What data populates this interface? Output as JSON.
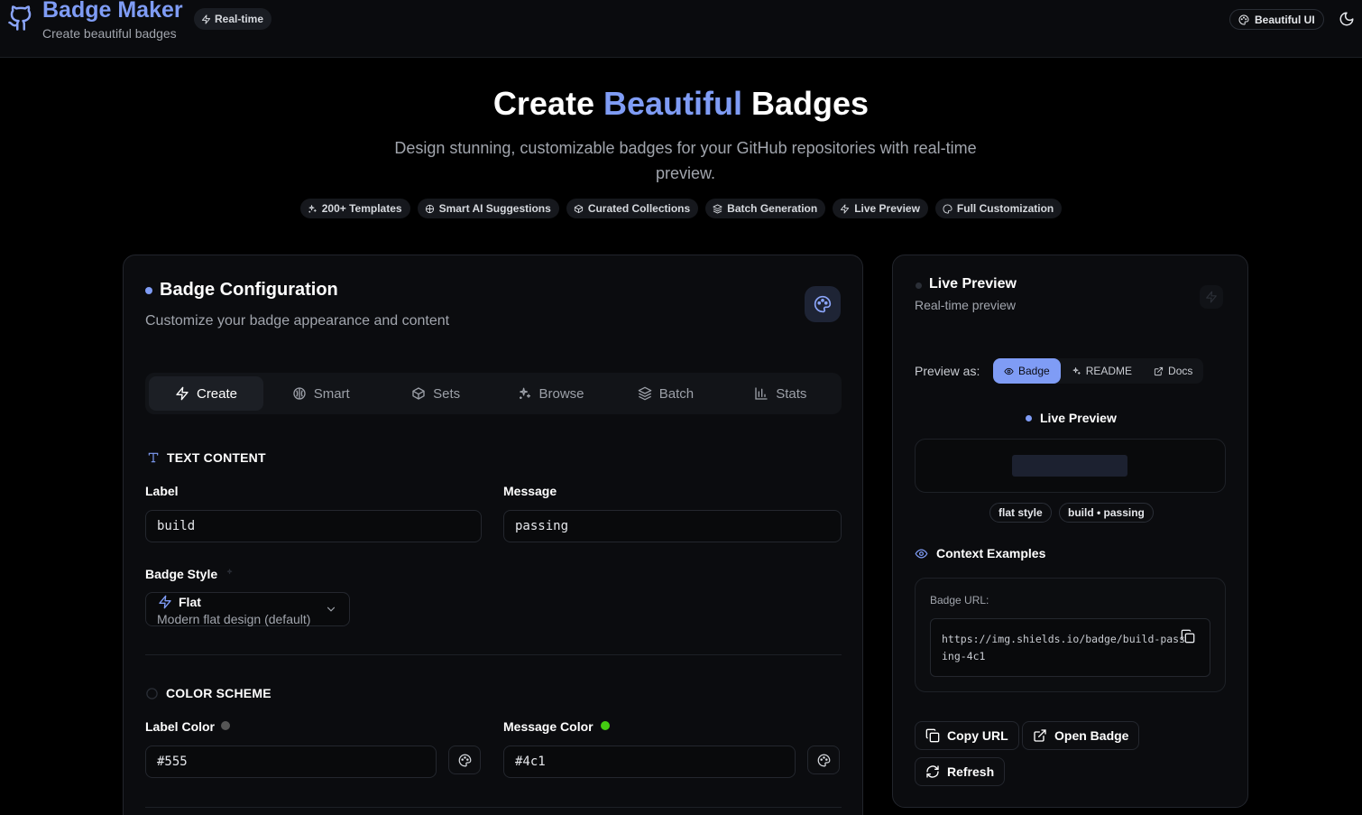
{
  "header": {
    "brand_title": "Badge Maker",
    "brand_subtitle": "Create beautiful badges",
    "realtime_pill": "Real-time",
    "beautiful_ui_label": "Beautiful UI",
    "theme_icon": "moon-icon"
  },
  "hero": {
    "title_pre": "Create",
    "title_accent": "Beautiful",
    "title_post": "Badges",
    "subtitle": "Design stunning, customizable badges for your GitHub repositories with real-time preview.",
    "features": [
      {
        "label": "200+ Templates",
        "icon": "sparkles-icon"
      },
      {
        "label": "Smart AI Suggestions",
        "icon": "brain-icon"
      },
      {
        "label": "Curated Collections",
        "icon": "package-icon"
      },
      {
        "label": "Batch Generation",
        "icon": "layers-icon"
      },
      {
        "label": "Live Preview",
        "icon": "zap-icon"
      },
      {
        "label": "Full Customization",
        "icon": "palette-icon"
      }
    ]
  },
  "config": {
    "title": "Badge Configuration",
    "subtitle": "Customize your badge appearance and content",
    "tabs": [
      {
        "label": "Create",
        "icon": "zap-icon",
        "active": true
      },
      {
        "label": "Smart",
        "icon": "brain-icon"
      },
      {
        "label": "Sets",
        "icon": "package-icon"
      },
      {
        "label": "Browse",
        "icon": "sparkles-icon"
      },
      {
        "label": "Batch",
        "icon": "layers-icon"
      },
      {
        "label": "Stats",
        "icon": "bar-chart-icon"
      }
    ],
    "text_section": "TEXT CONTENT",
    "label_field": {
      "label": "Label",
      "value": "build"
    },
    "message_field": {
      "label": "Message",
      "value": "passing"
    },
    "badge_style": {
      "label": "Badge Style",
      "selected_name": "Flat",
      "selected_desc": "Modern flat design (default)"
    },
    "color_section": "COLOR SCHEME",
    "label_color": {
      "label": "Label Color",
      "value": "#555",
      "swatch": "#555555"
    },
    "message_color": {
      "label": "Message Color",
      "value": "#4c1",
      "swatch": "#44cc11"
    }
  },
  "preview": {
    "title": "Live Preview",
    "subtitle": "Real-time preview",
    "preview_as_label": "Preview as:",
    "modes": [
      {
        "label": "Badge",
        "icon": "eye-icon",
        "active": true
      },
      {
        "label": "README",
        "icon": "sparkles-icon"
      },
      {
        "label": "Docs",
        "icon": "external-link-icon"
      }
    ],
    "live_label": "Live Preview",
    "chips": [
      "flat style",
      "build • passing"
    ],
    "context_title": "Context Examples",
    "badge_url_label": "Badge URL:",
    "badge_url": "https://img.shields.io/badge/build-passing-4c1",
    "actions": {
      "copy": "Copy URL",
      "open": "Open Badge",
      "refresh": "Refresh"
    }
  },
  "colors": {
    "accent": "#7f9cf5",
    "background": "#000000",
    "card": "#0b0c0f"
  }
}
